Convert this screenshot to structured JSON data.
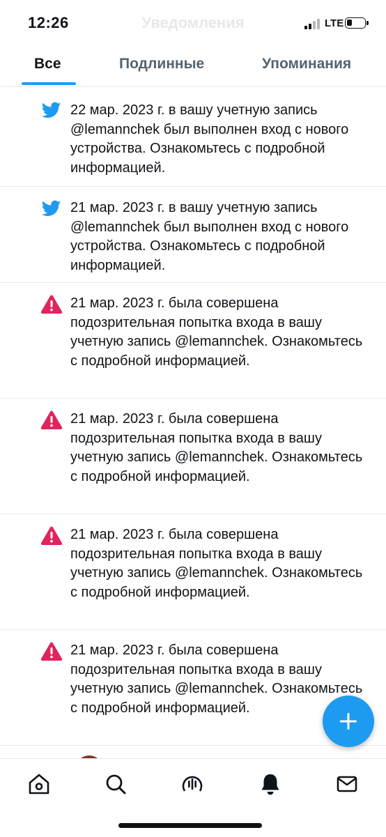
{
  "status_bar": {
    "time": "12:26",
    "network": "LTE",
    "faded_header_title": "Уведомления"
  },
  "tabs": [
    {
      "label": "Все",
      "active": true
    },
    {
      "label": "Подлинные",
      "active": false
    },
    {
      "label": "Упоминания",
      "active": false
    }
  ],
  "notifications": [
    {
      "icon": "twitter-bird-icon",
      "text": "22 мар. 2023 г. в вашу учетную запись @lemannchek был выполнен вход с нового устройства. Ознакомьтесь с подробной информацией."
    },
    {
      "icon": "twitter-bird-icon",
      "text": "21 мар. 2023 г. в вашу учетную запись @lemannchek был выполнен вход с нового устройства. Ознакомьтесь с подробной информацией."
    },
    {
      "icon": "warning-icon",
      "text": "21 мар. 2023 г. была совершена подозрительная попытка входа в вашу учетную запись @lemannchek. Ознакомьтесь с подробной информацией."
    },
    {
      "icon": "warning-icon",
      "text": "21 мар. 2023 г. была совершена подозрительная попытка входа в вашу учетную запись @lemannchek. Ознакомьтесь с подробной информацией."
    },
    {
      "icon": "warning-icon",
      "text": "21 мар. 2023 г. была совершена подозрительная попытка входа в вашу учетную запись @lemannchek. Ознакомьтесь с подробной информацией."
    },
    {
      "icon": "warning-icon",
      "text": "21 мар. 2023 г. была совершена подозрительная попытка входа в вашу учетную запись @lemannchek. Ознакомьтесь с подробной информацией."
    }
  ],
  "bottom_nav": [
    {
      "icon": "home-icon",
      "active": false
    },
    {
      "icon": "search-icon",
      "active": false
    },
    {
      "icon": "spaces-icon",
      "active": false
    },
    {
      "icon": "bell-icon",
      "active": true
    },
    {
      "icon": "mail-icon",
      "active": false
    }
  ],
  "fab": {
    "icon": "plus-icon"
  },
  "colors": {
    "accent": "#1d9bf0",
    "warning": "#e0245e",
    "text": "#0f1419",
    "secondary_text": "#536471",
    "divider": "#e6e9ec"
  }
}
